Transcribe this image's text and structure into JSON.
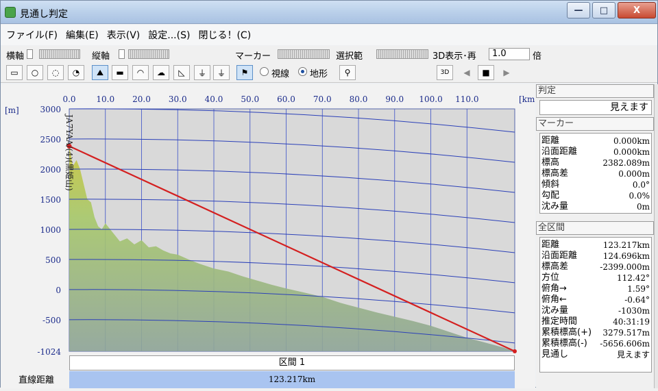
{
  "window": {
    "title": "見通し判定",
    "min": "—",
    "max": "□",
    "close": "X"
  },
  "menu": [
    "ファイル(F)",
    "編集(E)",
    "表示(V)",
    "設定...(S)",
    "閉じる！(C)"
  ],
  "toolbar": {
    "h_axis": "横軸",
    "v_axis": "縦軸",
    "marker": "マーカー",
    "range": "選択範",
    "view3d": "3D表示･再",
    "view3d_value": "1.0",
    "times": "倍",
    "sight_line": "視線",
    "terrain": "地形",
    "selected_mode": "地形",
    "view3d_btn": "3D"
  },
  "chart_data": {
    "type": "area",
    "xlabel": "[km]",
    "ylabel": "[m]",
    "x_ticks": [
      "0.0",
      "10.0",
      "20.0",
      "30.0",
      "40.0",
      "50.0",
      "60.0",
      "70.0",
      "80.0",
      "90.0",
      "100.0",
      "110.0"
    ],
    "x_tick_values": [
      0,
      10,
      20,
      30,
      40,
      50,
      60,
      70,
      80,
      90,
      100,
      110
    ],
    "y_ticks": [
      "3000",
      "2500",
      "2000",
      "1500",
      "1000",
      "500",
      "0",
      "-500",
      "-1024"
    ],
    "y_tick_values": [
      3000,
      2500,
      2000,
      1500,
      1000,
      500,
      0,
      -500,
      -1024
    ],
    "xlim": [
      0,
      123.217
    ],
    "ylim": [
      -1024,
      3000
    ],
    "grid": true,
    "point_label": "JA7YAA/(4)(黒姫山)",
    "sight_line": {
      "x": [
        0,
        123.217
      ],
      "y": [
        2382,
        -1024
      ]
    },
    "terrain": {
      "x": [
        0,
        1,
        2,
        3,
        4,
        5,
        6,
        7,
        8,
        9,
        10,
        12,
        14,
        16,
        18,
        20,
        22,
        24,
        26,
        28,
        30,
        33,
        36,
        40,
        44,
        48,
        52,
        56,
        60,
        65,
        70,
        75,
        80,
        85,
        90,
        95,
        100,
        105,
        110,
        115,
        120,
        123.217
      ],
      "y": [
        2382,
        2050,
        2150,
        2000,
        1750,
        1500,
        1450,
        1200,
        1050,
        1000,
        1100,
        950,
        800,
        850,
        750,
        820,
        700,
        720,
        650,
        600,
        580,
        500,
        430,
        350,
        300,
        220,
        150,
        80,
        20,
        -50,
        -120,
        -220,
        -300,
        -380,
        -450,
        -520,
        -600,
        -700,
        -800,
        -880,
        -960,
        -1024
      ]
    }
  },
  "section": {
    "title": "区間 1",
    "row_label": "直線距離",
    "value": "123.217km"
  },
  "panel": {
    "judgement_head": "判定",
    "judgement_value": "見えます",
    "marker_head": "マーカー",
    "marker": [
      {
        "k": "距離",
        "v": "0.000km"
      },
      {
        "k": "沿面距離",
        "v": "0.000km"
      },
      {
        "k": "標高",
        "v": "2382.089m"
      },
      {
        "k": "標高差",
        "v": "0.000m"
      },
      {
        "k": "傾斜",
        "v": "0.0°"
      },
      {
        "k": "勾配",
        "v": "0.0%"
      },
      {
        "k": "沈み量",
        "v": "0m"
      }
    ],
    "all_head": "全区間",
    "all": [
      {
        "k": "距離",
        "v": "123.217km"
      },
      {
        "k": "沿面距離",
        "v": "124.696km"
      },
      {
        "k": "標高差",
        "v": "-2399.000m"
      },
      {
        "k": "方位",
        "v": "112.42°"
      },
      {
        "k": "俯角→",
        "v": "1.59°"
      },
      {
        "k": "俯角←",
        "v": "-0.64°"
      },
      {
        "k": "沈み量",
        "v": "-1030m"
      },
      {
        "k": "推定時間",
        "v": "40:31:19"
      },
      {
        "k": "累積標高(+)",
        "v": "3279.517m"
      },
      {
        "k": "累積標高(-)",
        "v": "-5656.606m"
      },
      {
        "k": "見通し",
        "v": "見えます"
      }
    ]
  },
  "colors": {
    "terrain_top": "#b8c840",
    "terrain_bottom": "#8fa79a",
    "sight_line": "#d42020",
    "grid": "#2a3fb8",
    "section_bar": "#a9c4f0"
  }
}
